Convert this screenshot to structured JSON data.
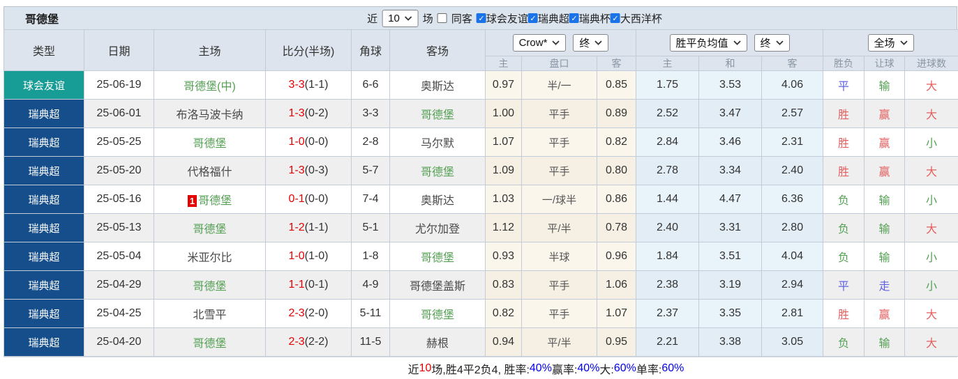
{
  "colors": {
    "teal_badge": "#189c96",
    "navy_badge": "#164e8c",
    "self_team_green": "#55a055",
    "score_red": "#e60000",
    "result_red": "#e55e5e",
    "result_green": "#55a055",
    "result_blue": "#6262e0",
    "footer_blue": "#0000ee",
    "header_bg": "#dde4ed",
    "cream_col": "#faf6ec",
    "blue_col": "#e9f3fa"
  },
  "topbar": {
    "title": "哥德堡",
    "recent_label": "近",
    "recent_value": "10",
    "matches_label": "场",
    "same_venue": {
      "label": "同客",
      "checked": false
    },
    "filters": [
      {
        "label": "球会友谊",
        "checked": true
      },
      {
        "label": "瑞典超",
        "checked": true
      },
      {
        "label": "瑞典杯",
        "checked": true
      },
      {
        "label": "大西洋杯",
        "checked": true
      }
    ]
  },
  "table": {
    "columns": [
      "类型",
      "日期",
      "主场",
      "比分(半场)",
      "角球",
      "客场"
    ],
    "subcolumns": [
      "主",
      "盘口",
      "客",
      "主",
      "和",
      "客",
      "胜负",
      "让球",
      "进球数"
    ],
    "dropdowns": {
      "odds_company": "Crow*",
      "odds_company_time": "终",
      "avg_odds": "胜平负均值",
      "avg_odds_time": "终",
      "scope": "全场"
    }
  },
  "rows": [
    {
      "type": "球会友谊",
      "type_style": "friendly",
      "date": "25-06-19",
      "home": "哥德堡(中)",
      "home_self": true,
      "home_rank": "",
      "score_ft": "3-3",
      "score_ht": "(1-1)",
      "corners": "6-6",
      "away": "奥斯达",
      "away_self": false,
      "crow_home": "0.97",
      "crow_line": "半/一",
      "crow_away": "0.85",
      "avg_home": "1.75",
      "avg_draw": "3.53",
      "avg_away": "4.06",
      "res_wdl": "平",
      "res_handicap": "输",
      "res_goals": "大"
    },
    {
      "type": "瑞典超",
      "type_style": "league",
      "date": "25-06-01",
      "home": "布洛马波卡纳",
      "home_self": false,
      "home_rank": "",
      "score_ft": "1-3",
      "score_ht": "(0-2)",
      "corners": "3-3",
      "away": "哥德堡",
      "away_self": true,
      "crow_home": "1.00",
      "crow_line": "平手",
      "crow_away": "0.89",
      "avg_home": "2.52",
      "avg_draw": "3.47",
      "avg_away": "2.57",
      "res_wdl": "胜",
      "res_handicap": "赢",
      "res_goals": "大"
    },
    {
      "type": "瑞典超",
      "type_style": "league",
      "date": "25-05-25",
      "home": "哥德堡",
      "home_self": true,
      "home_rank": "",
      "score_ft": "1-0",
      "score_ht": "(0-0)",
      "corners": "2-8",
      "away": "马尔默",
      "away_self": false,
      "crow_home": "1.07",
      "crow_line": "平手",
      "crow_away": "0.82",
      "avg_home": "2.84",
      "avg_draw": "3.46",
      "avg_away": "2.31",
      "res_wdl": "胜",
      "res_handicap": "赢",
      "res_goals": "小"
    },
    {
      "type": "瑞典超",
      "type_style": "league",
      "date": "25-05-20",
      "home": "代格福什",
      "home_self": false,
      "home_rank": "",
      "score_ft": "1-3",
      "score_ht": "(0-3)",
      "corners": "5-7",
      "away": "哥德堡",
      "away_self": true,
      "crow_home": "1.09",
      "crow_line": "平手",
      "crow_away": "0.80",
      "avg_home": "2.78",
      "avg_draw": "3.34",
      "avg_away": "2.40",
      "res_wdl": "胜",
      "res_handicap": "赢",
      "res_goals": "大"
    },
    {
      "type": "瑞典超",
      "type_style": "league",
      "date": "25-05-16",
      "home": "哥德堡",
      "home_self": true,
      "home_rank": "1",
      "score_ft": "0-1",
      "score_ht": "(0-0)",
      "corners": "7-4",
      "away": "奥斯达",
      "away_self": false,
      "crow_home": "1.03",
      "crow_line": "一/球半",
      "crow_away": "0.86",
      "avg_home": "1.44",
      "avg_draw": "4.47",
      "avg_away": "6.36",
      "res_wdl": "负",
      "res_handicap": "输",
      "res_goals": "小"
    },
    {
      "type": "瑞典超",
      "type_style": "league",
      "date": "25-05-13",
      "home": "哥德堡",
      "home_self": true,
      "home_rank": "",
      "score_ft": "1-2",
      "score_ht": "(1-1)",
      "corners": "5-1",
      "away": "尤尔加登",
      "away_self": false,
      "crow_home": "1.12",
      "crow_line": "平/半",
      "crow_away": "0.78",
      "avg_home": "2.40",
      "avg_draw": "3.31",
      "avg_away": "2.80",
      "res_wdl": "负",
      "res_handicap": "输",
      "res_goals": "大"
    },
    {
      "type": "瑞典超",
      "type_style": "league",
      "date": "25-05-04",
      "home": "米亚尔比",
      "home_self": false,
      "home_rank": "",
      "score_ft": "1-0",
      "score_ht": "(1-0)",
      "corners": "1-8",
      "away": "哥德堡",
      "away_self": true,
      "crow_home": "0.93",
      "crow_line": "半球",
      "crow_away": "0.96",
      "avg_home": "1.84",
      "avg_draw": "3.51",
      "avg_away": "4.04",
      "res_wdl": "负",
      "res_handicap": "输",
      "res_goals": "小"
    },
    {
      "type": "瑞典超",
      "type_style": "league",
      "date": "25-04-29",
      "home": "哥德堡",
      "home_self": true,
      "home_rank": "",
      "score_ft": "1-1",
      "score_ht": "(0-1)",
      "corners": "4-9",
      "away": "哥德堡盖斯",
      "away_self": false,
      "crow_home": "0.83",
      "crow_line": "平手",
      "crow_away": "1.06",
      "avg_home": "2.38",
      "avg_draw": "3.19",
      "avg_away": "2.94",
      "res_wdl": "平",
      "res_handicap": "走",
      "res_goals": "小"
    },
    {
      "type": "瑞典超",
      "type_style": "league",
      "date": "25-04-25",
      "home": "北雪平",
      "home_self": false,
      "home_rank": "",
      "score_ft": "2-3",
      "score_ht": "(2-0)",
      "corners": "5-11",
      "away": "哥德堡",
      "away_self": true,
      "crow_home": "0.82",
      "crow_line": "平手",
      "crow_away": "1.07",
      "avg_home": "2.37",
      "avg_draw": "3.35",
      "avg_away": "2.81",
      "res_wdl": "胜",
      "res_handicap": "赢",
      "res_goals": "大"
    },
    {
      "type": "瑞典超",
      "type_style": "league",
      "date": "25-04-20",
      "home": "哥德堡",
      "home_self": true,
      "home_rank": "",
      "score_ft": "2-3",
      "score_ht": "(2-2)",
      "corners": "11-5",
      "away": "赫根",
      "away_self": false,
      "crow_home": "0.94",
      "crow_line": "平/半",
      "crow_away": "0.95",
      "avg_home": "2.21",
      "avg_draw": "3.38",
      "avg_away": "3.05",
      "res_wdl": "负",
      "res_handicap": "输",
      "res_goals": "大"
    }
  ],
  "footer": {
    "segments": [
      {
        "text": "近",
        "color": "black"
      },
      {
        "text": "10",
        "color": "red"
      },
      {
        "text": "场,胜4平2负4, 胜率:",
        "color": "black"
      },
      {
        "text": "40%",
        "color": "blue"
      },
      {
        "text": " 赢率:",
        "color": "black"
      },
      {
        "text": "40%",
        "color": "blue"
      },
      {
        "text": " 大:",
        "color": "black"
      },
      {
        "text": "60%",
        "color": "blue"
      },
      {
        "text": " 单率:",
        "color": "black"
      },
      {
        "text": "60%",
        "color": "blue"
      }
    ]
  }
}
